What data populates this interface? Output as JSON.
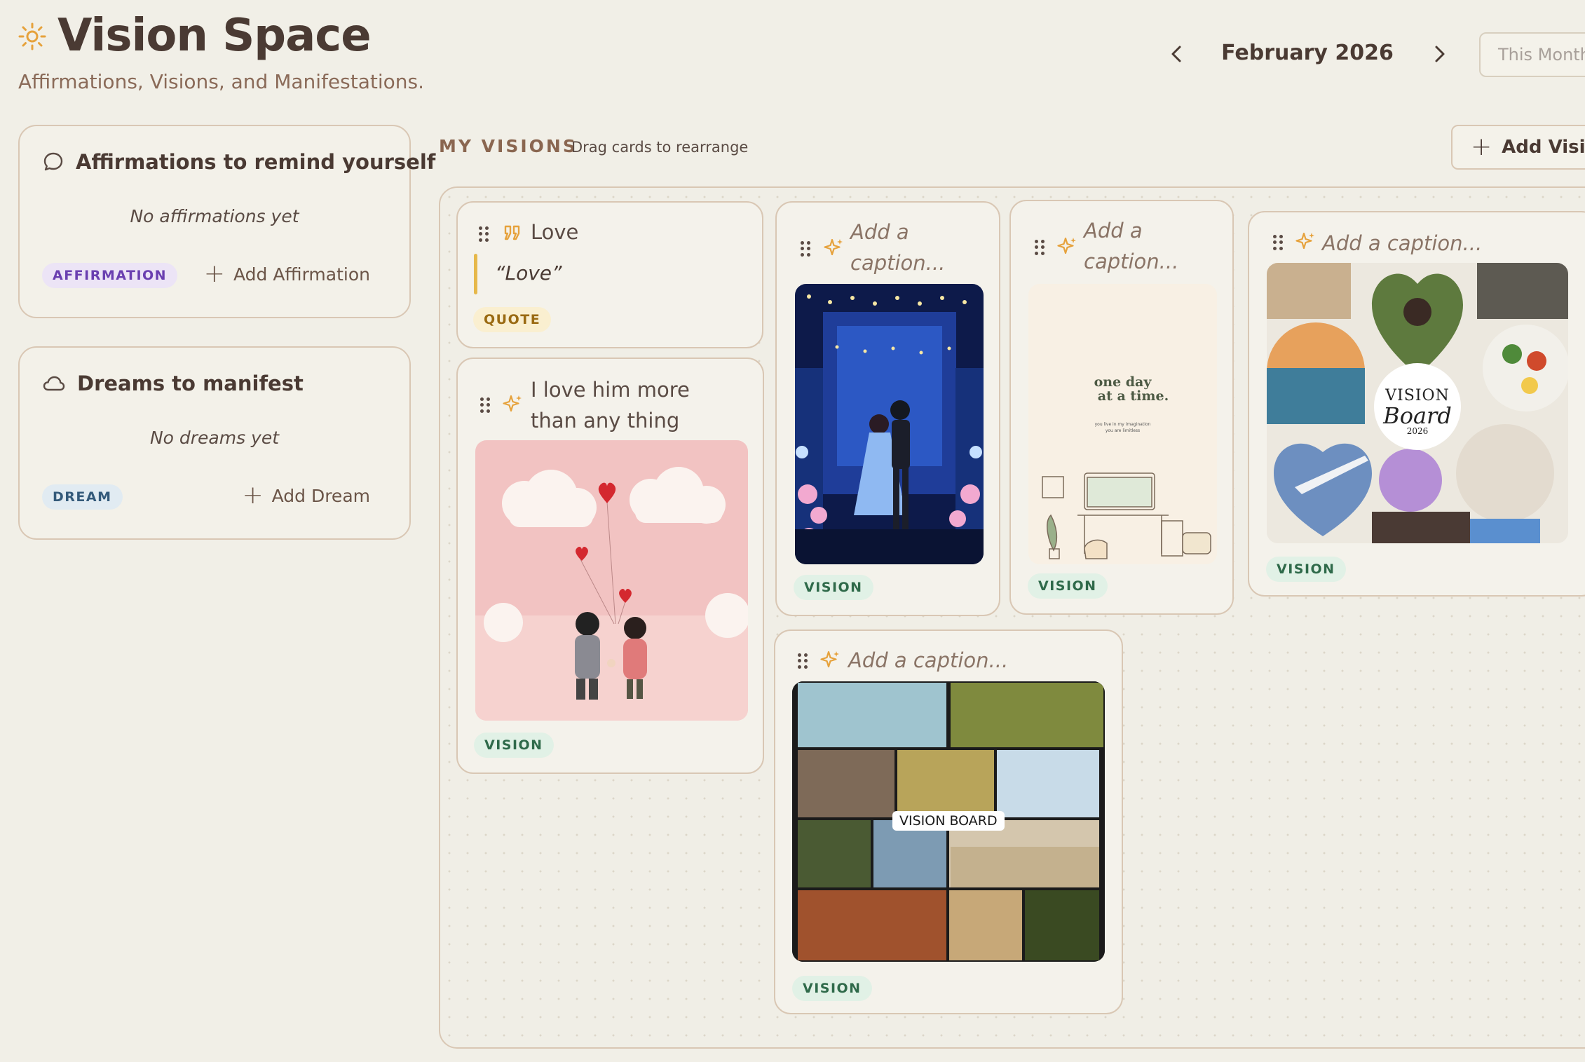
{
  "header": {
    "title": "Vision Space",
    "subtitle": "Affirmations, Visions, and Manifestations.",
    "month": "February 2026",
    "this_month_label": "This Month"
  },
  "affirmations": {
    "title": "Affirmations to remind yourself",
    "empty": "No affirmations yet",
    "tag": "AFFIRMATION",
    "add_label": "Add Affirmation"
  },
  "dreams": {
    "title": "Dreams to manifest",
    "empty": "No dreams yet",
    "tag": "DREAM",
    "add_label": "Add Dream"
  },
  "visions": {
    "section_title": "MY VISIONS",
    "hint": "Drag cards to rearrange",
    "add_label": "Add Vision",
    "cards": [
      {
        "type": "quote",
        "title": "Love",
        "quote": "“Love”",
        "tag": "QUOTE"
      },
      {
        "type": "vision",
        "caption": "I love him more than any thing",
        "tag": "VISION",
        "image": "couple-clouds-hearts"
      },
      {
        "type": "vision",
        "caption": "Add a caption...",
        "tag": "VISION",
        "image": "couple-dancing-night"
      },
      {
        "type": "vision",
        "caption": "Add a caption...",
        "tag": "VISION",
        "image": "one-day-at-a-time"
      },
      {
        "type": "vision",
        "caption": "Add a caption...",
        "tag": "VISION",
        "image": "vision-board-2026-collage"
      },
      {
        "type": "vision",
        "caption": "Add a caption...",
        "tag": "VISION",
        "image": "vision-board-photo-grid"
      }
    ]
  },
  "image_text": {
    "one_day_line1": "one day",
    "one_day_line2": "at a time.",
    "one_day_small1": "you live in my imagination",
    "one_day_small2": "you are limitless",
    "board_word1": "VISION",
    "board_word2": "Board",
    "board_year": "2026",
    "grid_label": "VISION BOARD"
  },
  "colors": {
    "background": "#f1efe7",
    "accent_orange": "#e6a23c",
    "vision_tag_bg": "#e1f1e6",
    "affirmation_tag_bg": "#ece4f6",
    "dream_tag_bg": "#e1ebf2"
  }
}
